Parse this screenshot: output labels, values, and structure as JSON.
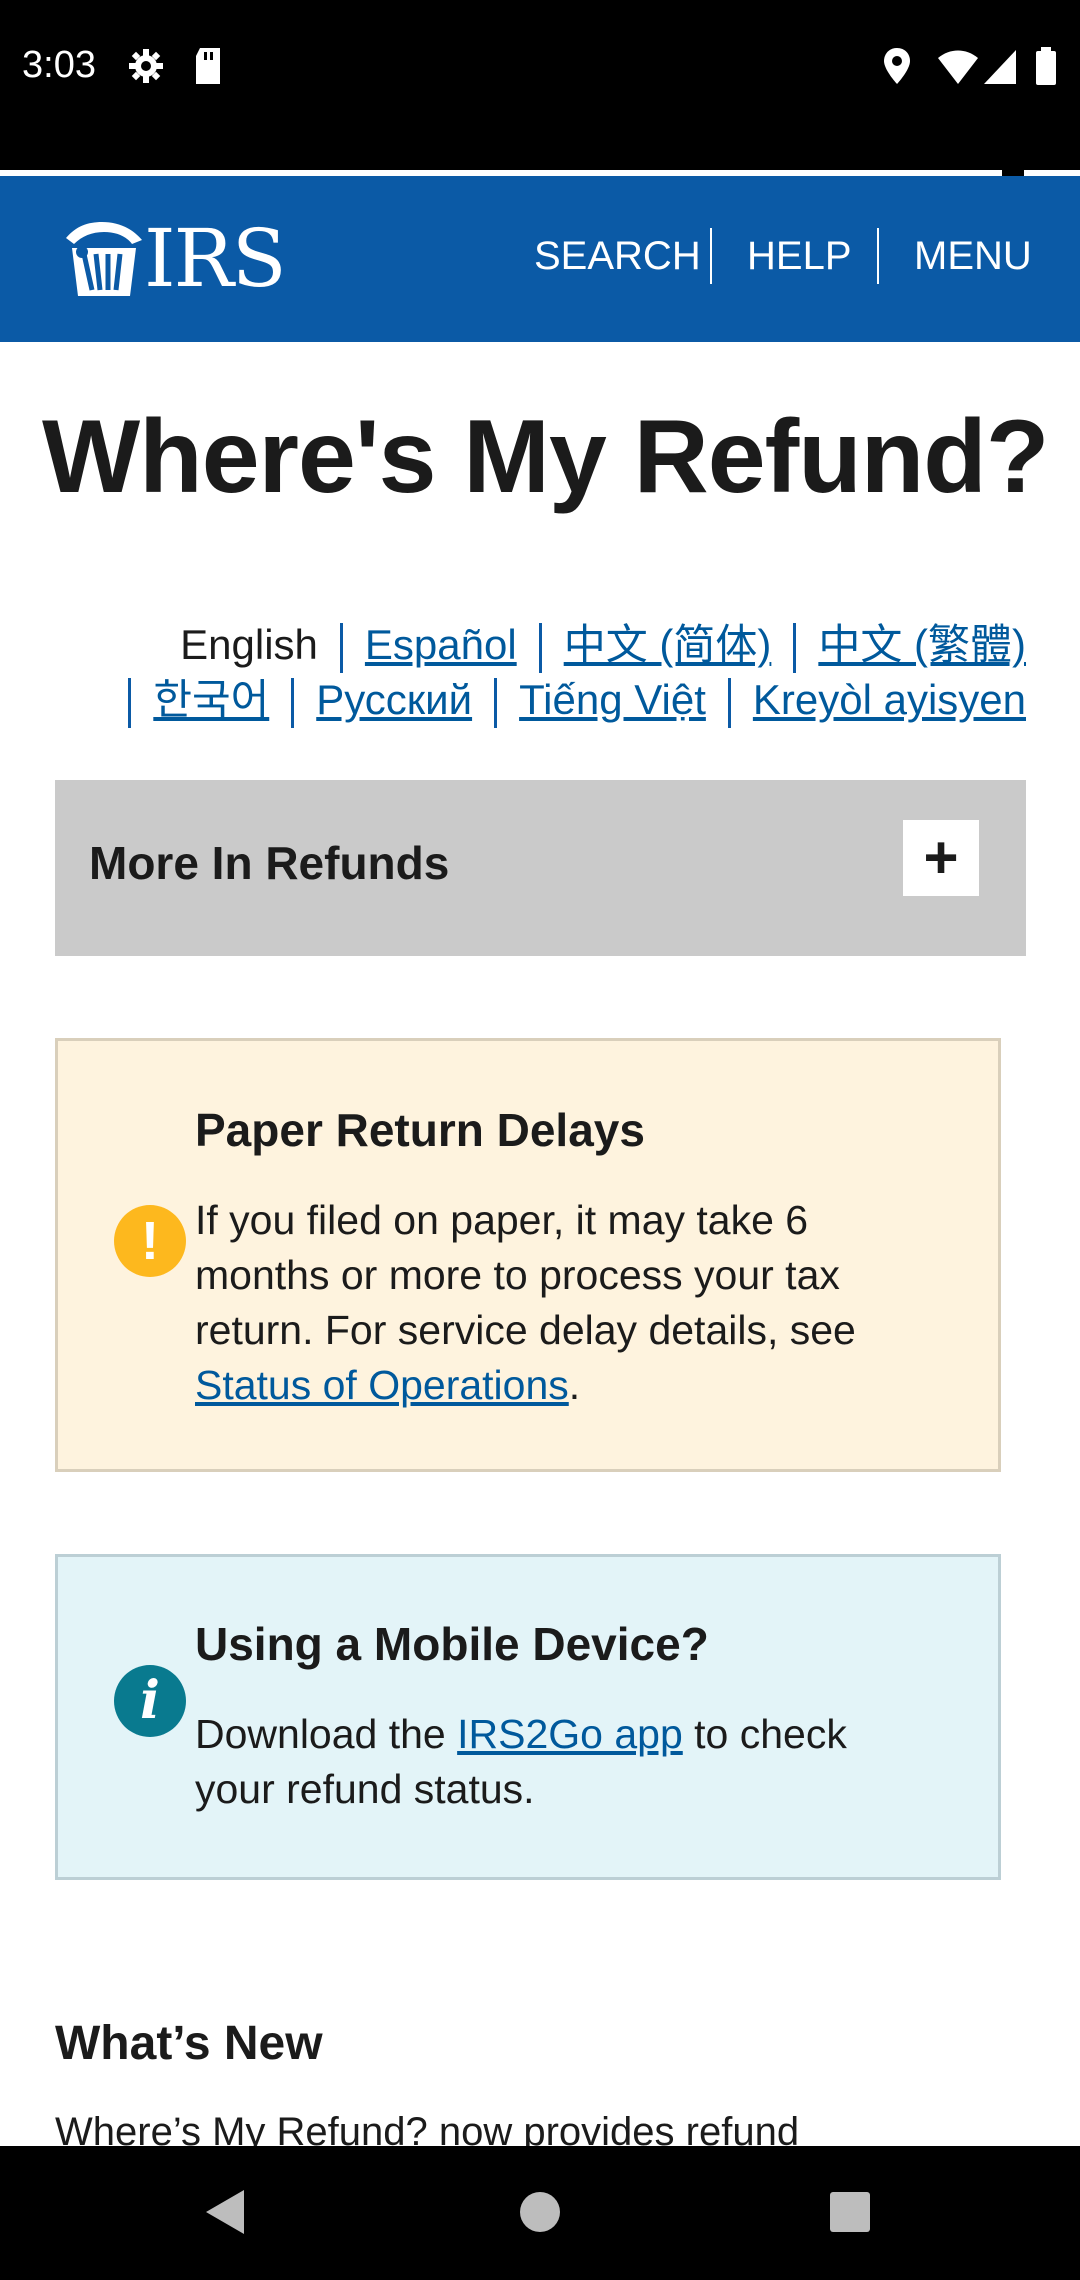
{
  "status_bar": {
    "time": "3:03"
  },
  "header": {
    "logo_text": "IRS",
    "nav": {
      "search": "SEARCH",
      "help": "HELP",
      "menu": "MENU"
    }
  },
  "page": {
    "title": "Where's My Refund?"
  },
  "languages": {
    "current": "English",
    "links": [
      "Español",
      "中文 (简体)",
      "中文 (繁體)",
      "한국어",
      "Русский",
      "Tiếng Việt",
      "Kreyòl ayisyen"
    ]
  },
  "accordion": {
    "label": "More In Refunds",
    "toggle": "+"
  },
  "alert_paper": {
    "heading": "Paper Return Delays",
    "body": "If you filed on paper, it may take 6 months or more to process your tax return. For service delay details, see ",
    "link": "Status of Operations",
    "end": "."
  },
  "alert_mobile": {
    "heading": "Using a Mobile Device?",
    "body_pre": "Download the ",
    "link": "IRS2Go app",
    "body_post": " to check your refund status."
  },
  "whats_new": {
    "heading": "What’s New",
    "text": "Where’s My Refund? now provides refund"
  },
  "colors": {
    "header_bg": "#0b5aa6",
    "link": "#00599c",
    "warning_bg": "#fef3de",
    "warning_icon": "#fdb81e",
    "info_bg": "#e3f4f8",
    "info_icon": "#097a8f",
    "accordion_bg": "#cacaca"
  }
}
